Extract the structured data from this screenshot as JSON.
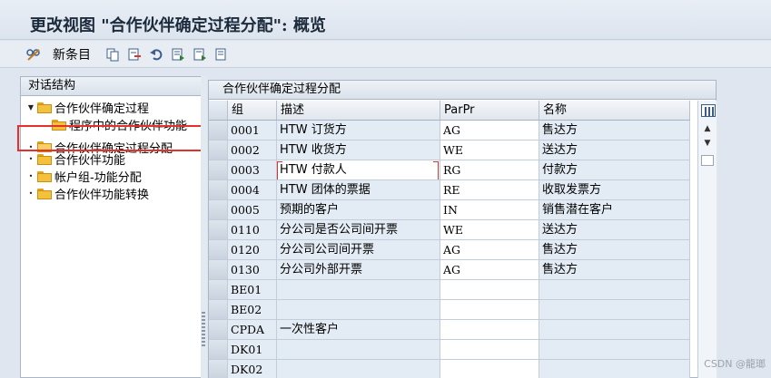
{
  "window": {
    "title": "更改视图 \"合作伙伴确定过程分配\": 概览"
  },
  "toolbar": {
    "new_entries_label": "新条目"
  },
  "tree": {
    "header": "对话结构",
    "items": [
      {
        "label": "合作伙伴确定过程",
        "level": 0,
        "toggle": "expanded",
        "folder": "closed"
      },
      {
        "label": "程序中的合作伙伴功能",
        "level": 1,
        "toggle": "",
        "folder": "closed"
      },
      {
        "label": "合作伙伴确定过程分配",
        "level": 0,
        "toggle": "bullet",
        "folder": "open",
        "selected": true
      },
      {
        "label": "合作伙伴功能",
        "level": 0,
        "toggle": "bullet",
        "folder": "closed"
      },
      {
        "label": "帐户组-功能分配",
        "level": 0,
        "toggle": "bullet",
        "folder": "closed"
      },
      {
        "label": "合作伙伴功能转换",
        "level": 0,
        "toggle": "bullet",
        "folder": "closed"
      }
    ]
  },
  "table": {
    "caption": "合作伙伴确定过程分配",
    "columns": [
      "组",
      "描述",
      "ParPr",
      "名称"
    ],
    "rows": [
      {
        "group": "0001",
        "desc": "HTW 订货方",
        "parpr": "AG",
        "name": "售达方"
      },
      {
        "group": "0002",
        "desc": "HTW 收货方",
        "parpr": "WE",
        "name": "送达方"
      },
      {
        "group": "0003",
        "desc": "HTW 付款人",
        "parpr": "RG",
        "name": "付款方",
        "focus": true
      },
      {
        "group": "0004",
        "desc": "HTW 团体的票据",
        "parpr": "RE",
        "name": "收取发票方"
      },
      {
        "group": "0005",
        "desc": "预期的客户",
        "parpr": "IN",
        "name": "销售潜在客户"
      },
      {
        "group": "0110",
        "desc": "分公司是否公司间开票",
        "parpr": "WE",
        "name": "送达方"
      },
      {
        "group": "0120",
        "desc": "分公司公司间开票",
        "parpr": "AG",
        "name": "售达方"
      },
      {
        "group": "0130",
        "desc": "分公司外部开票",
        "parpr": "AG",
        "name": "售达方"
      },
      {
        "group": "BE01",
        "desc": "",
        "parpr": "",
        "name": ""
      },
      {
        "group": "BE02",
        "desc": "",
        "parpr": "",
        "name": ""
      },
      {
        "group": "CPDA",
        "desc": "一次性客户",
        "parpr": "",
        "name": ""
      },
      {
        "group": "DK01",
        "desc": "",
        "parpr": "",
        "name": ""
      },
      {
        "group": "DK02",
        "desc": "",
        "parpr": "",
        "name": ""
      }
    ]
  },
  "watermark": "CSDN @龍瑯",
  "colors": {
    "selection_outline": "#e5312b",
    "folder": "#f4c13c",
    "cell_bg": "#e3ecf4"
  }
}
